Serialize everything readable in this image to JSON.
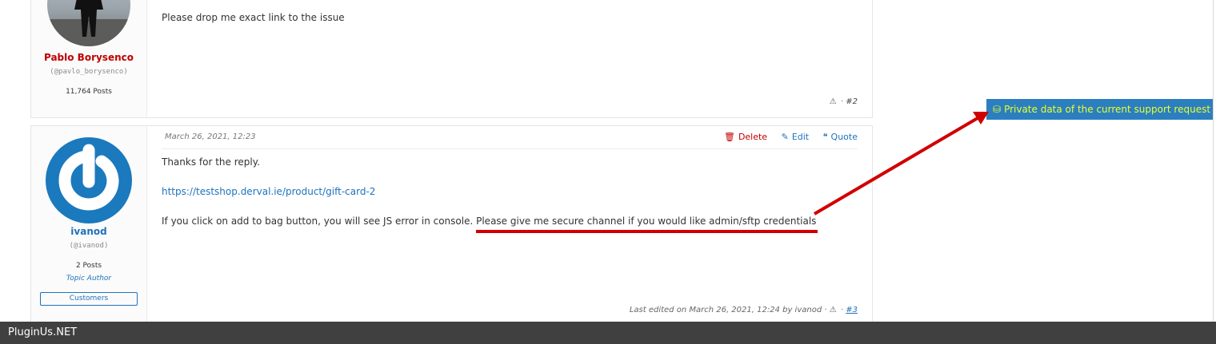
{
  "posts": [
    {
      "author": {
        "name": "Pablo Borysenco",
        "handle": "(@pavlo_borysenco)",
        "posts": "11,764 Posts"
      },
      "body": [
        "Please  drop  me  exact  link to the  issue"
      ],
      "footer": {
        "sep": "·",
        "number": "#2"
      }
    },
    {
      "author": {
        "name": "ivanod",
        "handle": "(@ivanod)",
        "posts": "2 Posts",
        "role": "Topic Author",
        "group": "Customers"
      },
      "date": "March 26, 2021, 12:23",
      "actions": {
        "delete": "Delete",
        "edit": "Edit",
        "quote": "Quote"
      },
      "body": {
        "line1": "Thanks for the reply.",
        "link": "https://testshop.derval.ie/product/gift-card-2",
        "line3a": "If you click on add to bag button, you will see JS error in console. ",
        "line3b": "Please give me secure channel if you would like admin/sftp credentials"
      },
      "footer": {
        "edited": "Last edited on March 26, 2021, 12:24 by ivanod ·",
        "sep": "·",
        "number": "#3"
      }
    }
  ],
  "private_data_button": "Private data of the current support request",
  "bottom_bar": {
    "brand": "PluginUs.NET"
  },
  "icons": {
    "trash": "trash-icon",
    "pencil": "pencil-icon",
    "quote": "quote-icon",
    "warning": "warning-icon",
    "database": "database-icon"
  },
  "colors": {
    "accent_blue": "#1e72bd",
    "admin_red": "#c00000",
    "button_bg": "#2b7fc0",
    "button_text": "#e9ff2a",
    "annotation_red": "#d10000",
    "bottom_bar": "#404040"
  }
}
